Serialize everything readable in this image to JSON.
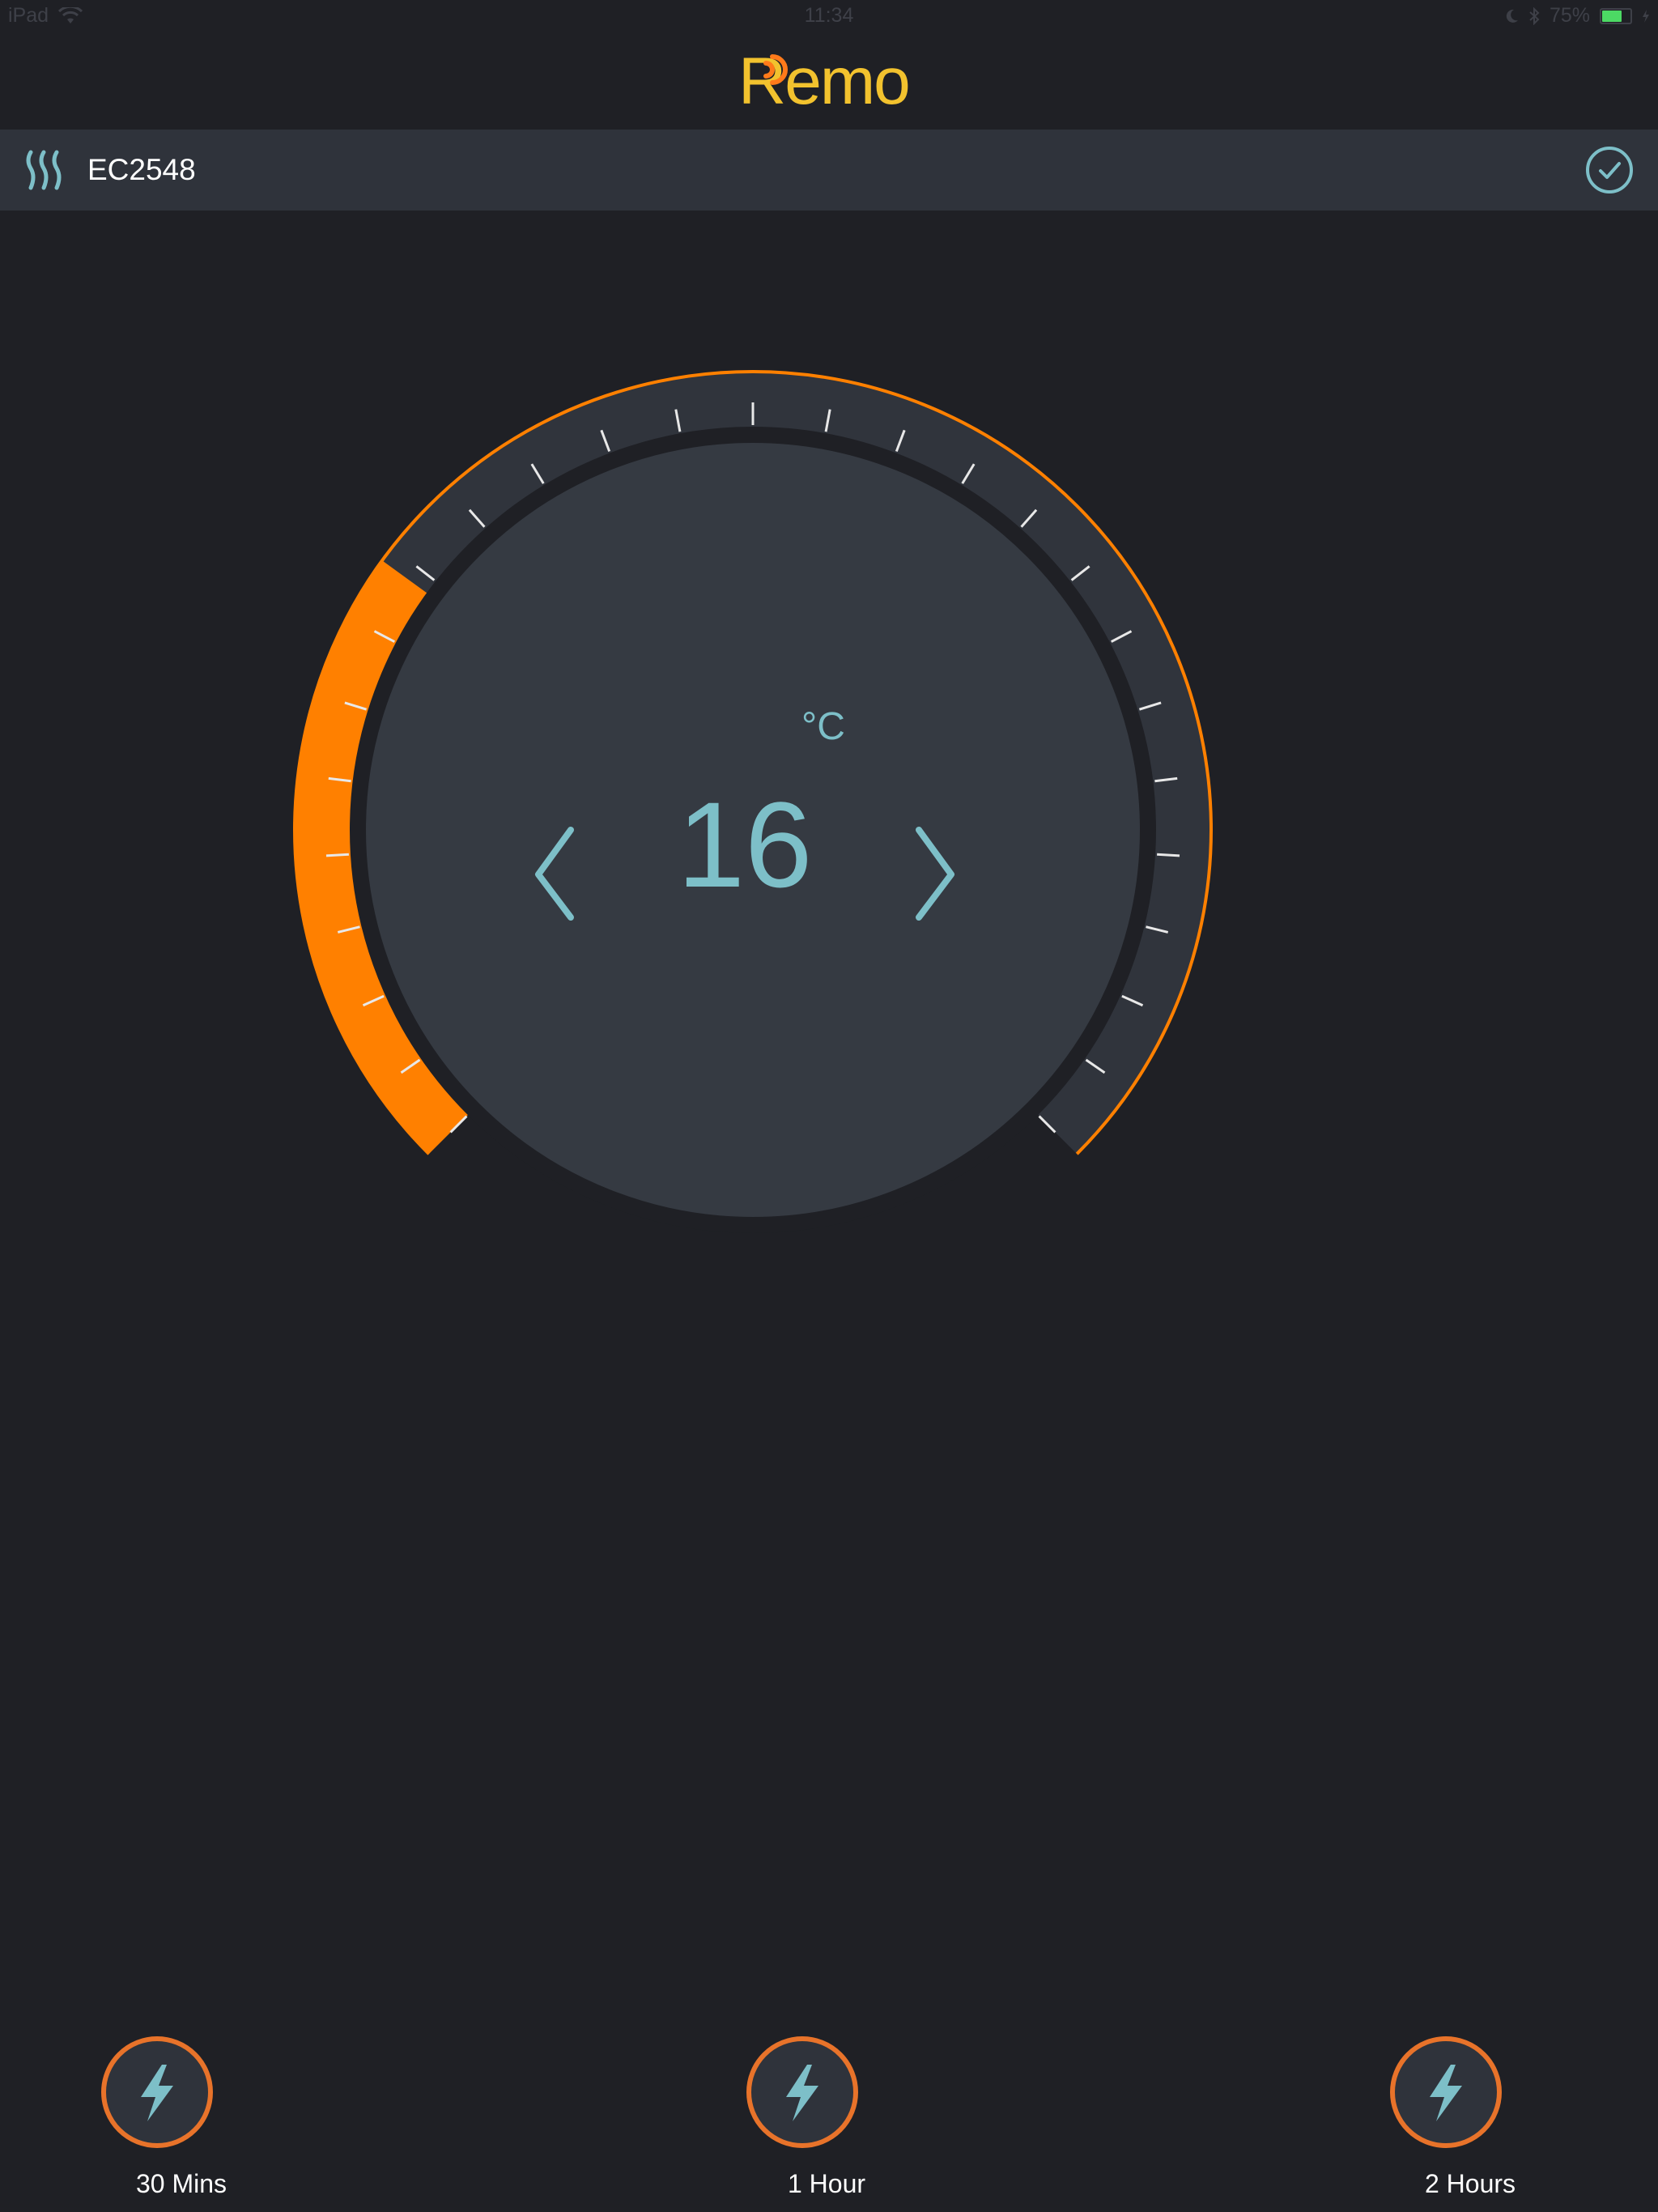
{
  "status_bar": {
    "device": "iPad",
    "time": "11:34",
    "battery_percent_text": "75%",
    "battery_level": 0.75,
    "icons": [
      "wifi-icon",
      "moon-icon",
      "bluetooth-icon",
      "battery-icon",
      "charging-icon"
    ]
  },
  "app": {
    "logo_text": "Remo",
    "brand_color": "#f2c22e",
    "signal_color": "#ff7a1a"
  },
  "device_bar": {
    "icon": "heater-icon",
    "name": "EC2548",
    "confirm_icon": "check-circle-icon"
  },
  "thermostat": {
    "unit": "°C",
    "setpoint": "16",
    "setpoint_fraction": 0.3,
    "active_color": "#ff8000",
    "track_color": "#30343c",
    "decrease_icon": "chevron-left-icon",
    "increase_icon": "chevron-right-icon"
  },
  "boost_buttons": [
    {
      "label": "30 Mins",
      "icon": "lightning-icon"
    },
    {
      "label": "1 Hour",
      "icon": "lightning-icon"
    },
    {
      "label": "2 Hours",
      "icon": "lightning-icon"
    }
  ],
  "colors": {
    "background": "#1f2025",
    "accent_text": "#7dbfc8",
    "boost_ring": "#e8732a"
  }
}
